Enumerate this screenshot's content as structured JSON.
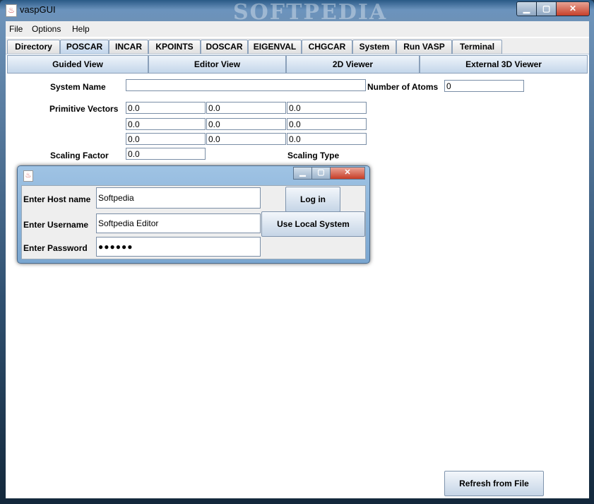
{
  "window": {
    "title": "vaspGUI",
    "watermark": "SOFTPEDIA",
    "controls": {
      "minimize": "▁",
      "maximize": "▢",
      "close": "✕"
    }
  },
  "menubar": {
    "items": [
      "File",
      "Options",
      "Help"
    ]
  },
  "tabs": {
    "items": [
      "Directory",
      "POSCAR",
      "INCAR",
      "KPOINTS",
      "DOSCAR",
      "EIGENVAL",
      "CHGCAR",
      "System",
      "Run VASP",
      "Terminal"
    ],
    "active": "POSCAR"
  },
  "subtabs": {
    "items": [
      "Guided View",
      "Editor View",
      "2D Viewer",
      "External 3D Viewer"
    ]
  },
  "form": {
    "system_name_label": "System Name",
    "system_name_value": "",
    "num_atoms_label": "Number of Atoms",
    "num_atoms_value": "0",
    "primitive_vectors_label": "Primitive Vectors",
    "vectors": [
      [
        "0.0",
        "0.0",
        "0.0"
      ],
      [
        "0.0",
        "0.0",
        "0.0"
      ],
      [
        "0.0",
        "0.0",
        "0.0"
      ]
    ],
    "scaling_factor_label": "Scaling Factor",
    "scaling_factor_value": "0.0",
    "scaling_type_label": "Scaling Type"
  },
  "dialog": {
    "host_label": "Enter Host name",
    "host_value": "Softpedia",
    "username_label": "Enter Username",
    "username_value": "Softpedia Editor",
    "password_label": "Enter Password",
    "password_value": "●●●●●●",
    "login_button": "Log in",
    "local_button": "Use Local System"
  },
  "refresh_button": "Refresh from File"
}
